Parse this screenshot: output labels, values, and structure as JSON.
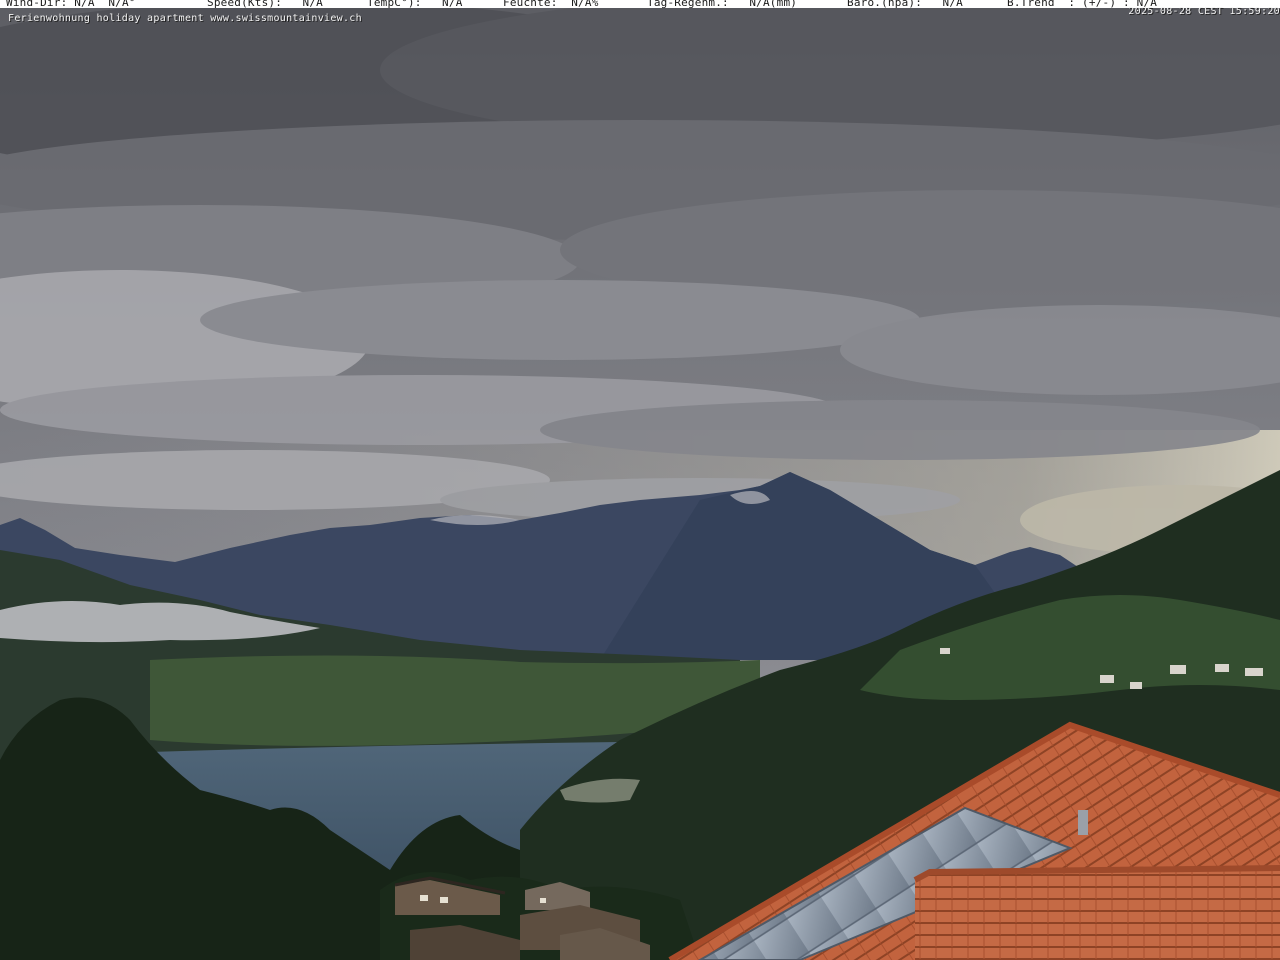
{
  "overlay": {
    "wind_dir": "Wind-Dir: N/A  N/A°",
    "speed": "Speed(Kts):   N/A",
    "temp": "TempC°):   N/A",
    "humidity": "Feuchte:  N/A%",
    "rain": "Tag-Regenm.:   N/A(mm)",
    "baro": "Baro.(hpa):   N/A",
    "trend": "B.Trend  : (+/-) : N/A",
    "site": "Ferienwohnung holiday apartment www.swissmountainview.ch",
    "timestamp": "2025-08-28 CEST 15:59:20"
  },
  "scene": {
    "sky_color": "#7a7b82",
    "cloud_dark": "#55565c",
    "cloud_light": "#b9b9bf",
    "mountain_color": "#3d4a63",
    "forest_color": "#1f2d1f",
    "lake_color": "#4b6176",
    "roof_color": "#c0623d",
    "solar_color": "#8e9bab"
  }
}
